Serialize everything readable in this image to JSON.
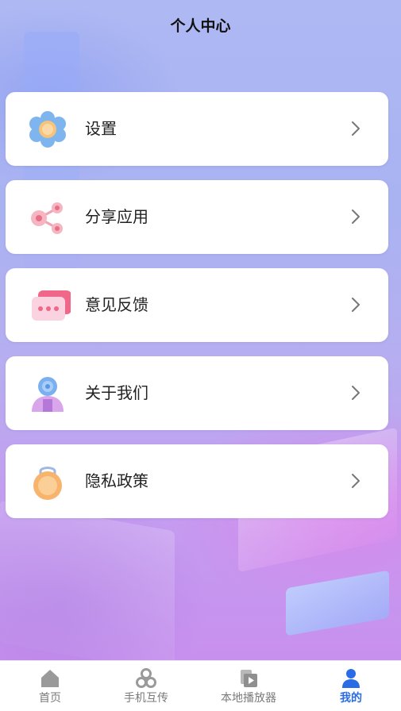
{
  "header": {
    "title": "个人中心"
  },
  "menu": {
    "items": [
      {
        "label": "设置",
        "icon": "flower-settings-icon"
      },
      {
        "label": "分享应用",
        "icon": "share-icon"
      },
      {
        "label": "意见反馈",
        "icon": "feedback-chat-icon"
      },
      {
        "label": "关于我们",
        "icon": "user-avatar-icon"
      },
      {
        "label": "隐私政策",
        "icon": "privacy-lock-icon"
      }
    ],
    "chevron_icon": "chevron-right-icon"
  },
  "tabbar": {
    "tabs": [
      {
        "label": "首页",
        "icon": "home-icon",
        "active": false
      },
      {
        "label": "手机互传",
        "icon": "transfer-icon",
        "active": false
      },
      {
        "label": "本地播放器",
        "icon": "player-icon",
        "active": false
      },
      {
        "label": "我的",
        "icon": "profile-icon",
        "active": true
      }
    ],
    "active_color": "#2a6be6",
    "inactive_color": "#7a7a7a"
  }
}
